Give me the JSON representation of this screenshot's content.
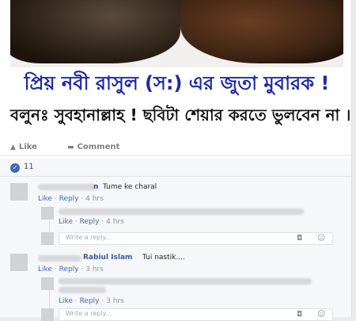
{
  "post": {
    "caption_line1": "প্রিয় নবী রাসুল (স:) এর জুতা মুবারক !",
    "caption_line2": "বলুনঃ সুবহানাল্লাহ ! ছবিটা শেয়ার করতে ভুলবেন না ।",
    "actions": {
      "like": "Like",
      "comment": "Comment"
    },
    "like_count": "11"
  },
  "comments": [
    {
      "author": "...n",
      "text": "Tume ke charal",
      "like": "Like",
      "reply": "Reply",
      "sep": "·",
      "time": "4 hrs",
      "replies": [
        {
          "like": "Like",
          "reply": "Reply",
          "sep": "·",
          "time": "4 hrs"
        }
      ],
      "reply_placeholder": "Write a reply..."
    },
    {
      "author": "... Rabiul Islam",
      "text": "Tui nastik....",
      "like": "Like",
      "reply": "Reply",
      "sep": "·",
      "time": "3 hrs",
      "replies": [
        {
          "like": "Like",
          "reply": "Reply",
          "sep": "·",
          "time": "3 hrs"
        }
      ],
      "reply_placeholder": "Write a reply..."
    }
  ],
  "icons": {
    "like_thumb": "👍",
    "comment_bubble": "💬",
    "camera": "📷",
    "smiley": "☺"
  }
}
